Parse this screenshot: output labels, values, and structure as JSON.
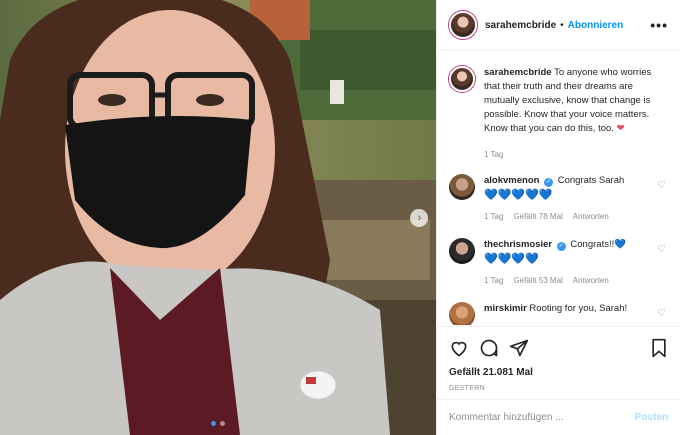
{
  "post": {
    "username": "sarahemcbride",
    "separator": "•",
    "follow_label": "Abonnieren",
    "more_label": "•••",
    "next_arrow": "›"
  },
  "caption": {
    "username": "sarahemcbride",
    "text": "To anyone who worries that their truth and their dreams are mutually exclusive, know that change is possible. Know that your voice matters. Know that you can do this, too.",
    "emoji": "❤",
    "time": "1 Tag"
  },
  "comments": [
    {
      "username": "alokvmenon",
      "text": "Congrats Sarah",
      "hearts": "💙💙💙💙💙",
      "time": "1 Tag",
      "likes": "Gefällt 78 Mal",
      "reply": "Antworten"
    },
    {
      "username": "thechrismosier",
      "text": "Congrats!!💙",
      "hearts": "💙💙💙💙",
      "time": "1 Tag",
      "likes": "Gefällt 53 Mal",
      "reply": "Antworten"
    },
    {
      "username": "mirskimir",
      "text": "Rooting for you, Sarah!"
    }
  ],
  "icons": {
    "heart": "heart-icon",
    "comment": "comment-icon",
    "share": "share-icon",
    "save": "bookmark-icon",
    "verified": "✓",
    "small_heart": "♡"
  },
  "likes_total": "Gefällt 21.081 Mal",
  "post_date": "GESTERN",
  "comment_input": {
    "placeholder": "Kommentar hinzufügen ...",
    "post_label": "Posten"
  },
  "colors": {
    "accent": "#0095f6",
    "post_disabled": "#b2dffc",
    "heart_emoji": "#ed4956"
  }
}
